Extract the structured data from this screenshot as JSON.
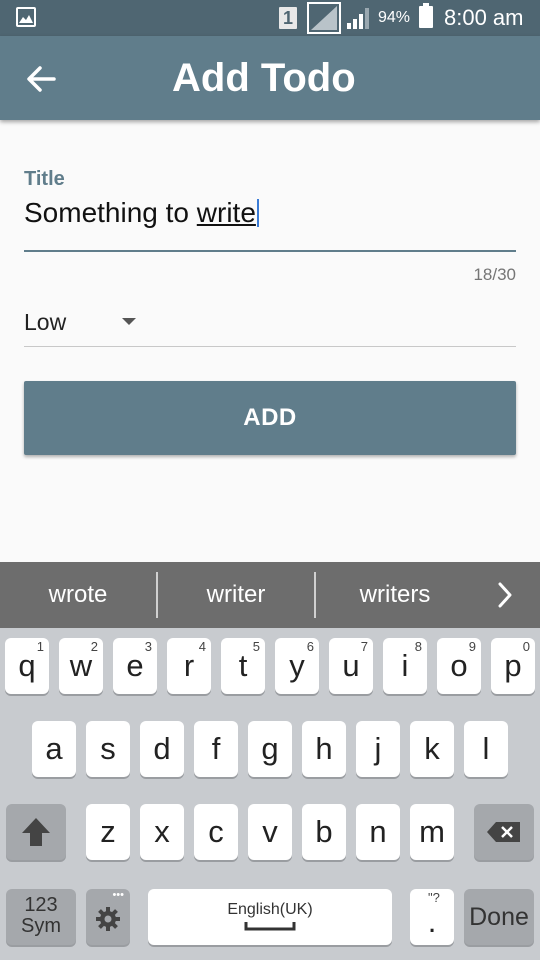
{
  "status_bar": {
    "sim_slot": "1",
    "battery_pct": "94%",
    "time": "8:00 am"
  },
  "app_bar": {
    "title": "Add Todo",
    "back_icon": "arrow-left-icon"
  },
  "form": {
    "title_field": {
      "label": "Title",
      "value_prefix": "Something to ",
      "value_composing": "write",
      "counter": "18/30"
    },
    "priority_select": {
      "value": "Low"
    },
    "add_button": "ADD"
  },
  "suggestions": [
    "wrote",
    "writer",
    "writers"
  ],
  "keyboard": {
    "row1": [
      {
        "c": "q",
        "n": "1"
      },
      {
        "c": "w",
        "n": "2"
      },
      {
        "c": "e",
        "n": "3"
      },
      {
        "c": "r",
        "n": "4"
      },
      {
        "c": "t",
        "n": "5"
      },
      {
        "c": "y",
        "n": "6"
      },
      {
        "c": "u",
        "n": "7"
      },
      {
        "c": "i",
        "n": "8"
      },
      {
        "c": "o",
        "n": "9"
      },
      {
        "c": "p",
        "n": "0"
      }
    ],
    "row2": [
      "a",
      "s",
      "d",
      "f",
      "g",
      "h",
      "j",
      "k",
      "l"
    ],
    "row3": [
      "z",
      "x",
      "c",
      "v",
      "b",
      "n",
      "m"
    ],
    "sym_label_1": "123",
    "sym_label_2": "Sym",
    "settings_dots": "•••",
    "space_label": "English(UK)",
    "period_sup": "\"?",
    "period": ".",
    "done_label": "Done"
  },
  "colors": {
    "primary": "#607d8b",
    "status_bar": "#4f6672",
    "accent_cursor": "#3a7bd5"
  }
}
